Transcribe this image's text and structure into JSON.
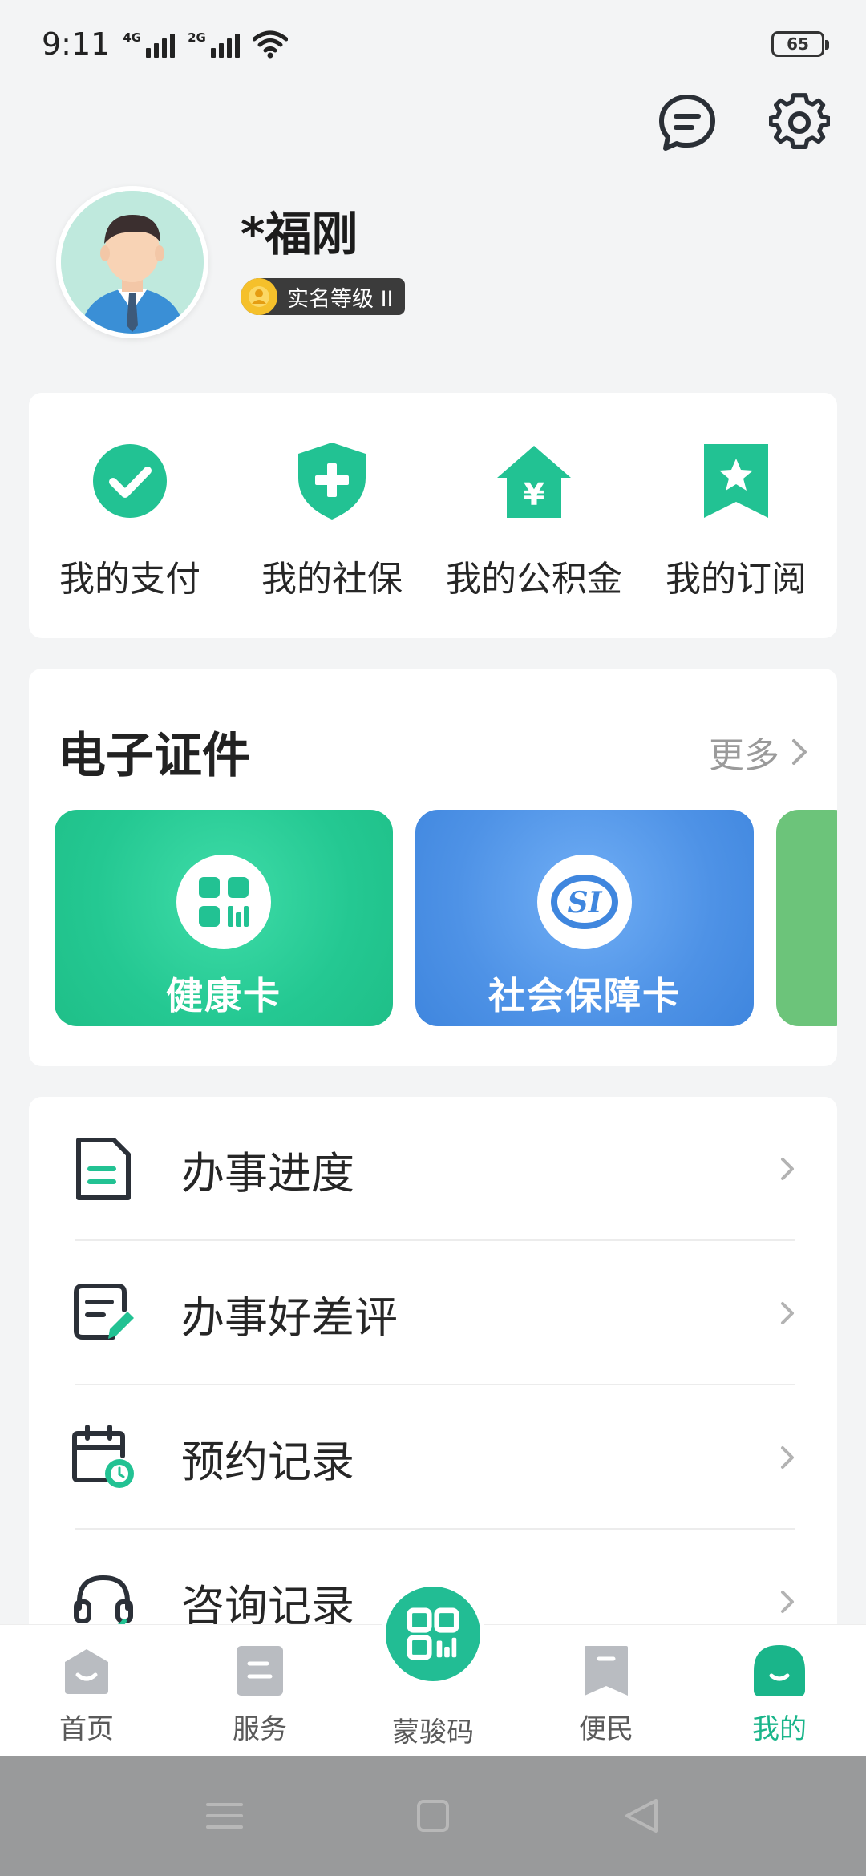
{
  "status_bar": {
    "time": "9:11",
    "signal_1_tag": "4G",
    "signal_2_tag": "2G",
    "battery": "65"
  },
  "top_actions": {
    "message_icon": "message-icon",
    "settings_icon": "gear-icon"
  },
  "profile": {
    "name": "*福刚",
    "verification_badge": "实名等级 II"
  },
  "quick_actions": [
    {
      "label": "我的支付",
      "icon": "check-circle-icon"
    },
    {
      "label": "我的社保",
      "icon": "shield-plus-icon"
    },
    {
      "label": "我的公积金",
      "icon": "house-yen-icon"
    },
    {
      "label": "我的订阅",
      "icon": "bookmark-star-icon"
    }
  ],
  "certificates": {
    "title": "电子证件",
    "more_label": "更多",
    "items": [
      {
        "label": "健康卡",
        "icon": "qr-code-icon",
        "color": "#24c892"
      },
      {
        "label": "社会保障卡",
        "icon": "si-logo-icon",
        "color": "#4e92e6"
      }
    ]
  },
  "menu": [
    {
      "label": "办事进度",
      "icon": "document-icon"
    },
    {
      "label": "办事好差评",
      "icon": "feedback-edit-icon"
    },
    {
      "label": "预约记录",
      "icon": "calendar-clock-icon"
    },
    {
      "label": "咨询记录",
      "icon": "headset-icon"
    }
  ],
  "bottom_nav": [
    {
      "label": "首页",
      "icon": "home-icon"
    },
    {
      "label": "服务",
      "icon": "service-icon"
    },
    {
      "label": "蒙骏码",
      "icon": "qr-code-icon"
    },
    {
      "label": "便民",
      "icon": "bookmark-icon"
    },
    {
      "label": "我的",
      "icon": "profile-icon",
      "active": true
    }
  ],
  "colors": {
    "accent": "#22bd94",
    "active_nav": "#1ab58a",
    "health_card": "#24c892",
    "social_card": "#4e92e6"
  }
}
